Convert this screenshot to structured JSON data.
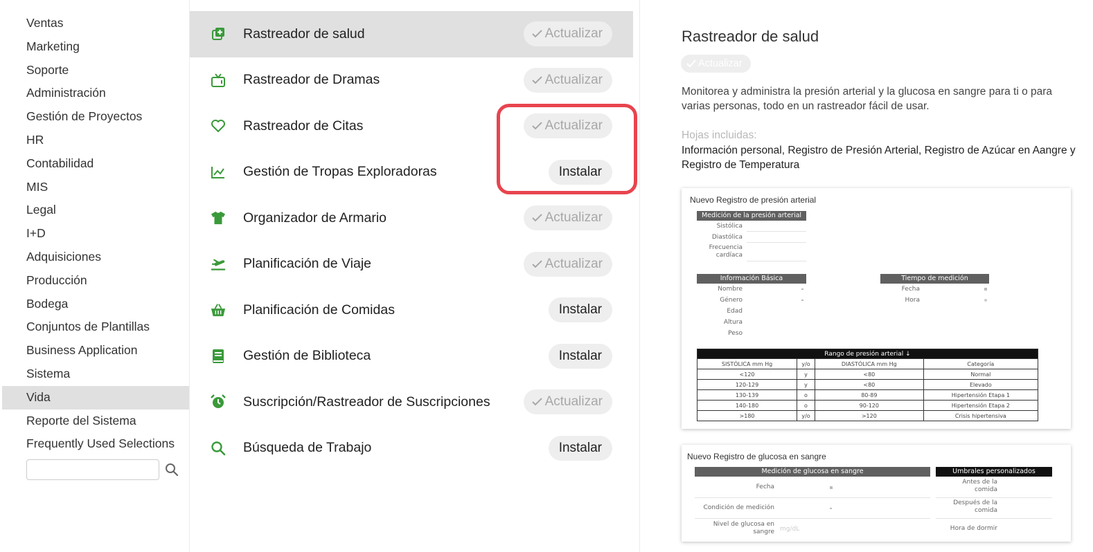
{
  "sidebar": {
    "items": [
      {
        "label": "Ventas"
      },
      {
        "label": "Marketing"
      },
      {
        "label": "Soporte"
      },
      {
        "label": "Administración"
      },
      {
        "label": "Gestión de Proyectos"
      },
      {
        "label": "HR"
      },
      {
        "label": "Contabilidad"
      },
      {
        "label": "MIS"
      },
      {
        "label": "Legal"
      },
      {
        "label": "I+D"
      },
      {
        "label": "Adquisiciones"
      },
      {
        "label": "Producción"
      },
      {
        "label": "Bodega"
      },
      {
        "label": "Conjuntos de Plantillas"
      },
      {
        "label": "Business Application"
      },
      {
        "label": "Sistema"
      },
      {
        "label": "Vida",
        "active": true
      },
      {
        "label": "Reporte del Sistema"
      },
      {
        "label": "Frequently Used Selections"
      }
    ],
    "search_placeholder": ""
  },
  "templates": {
    "items": [
      {
        "name": "Rastreador de salud",
        "action": "Actualizar",
        "icon": "health-plus-icon",
        "selected": true
      },
      {
        "name": "Rastreador de Dramas",
        "action": "Actualizar",
        "icon": "tv-icon"
      },
      {
        "name": "Rastreador de Citas",
        "action": "Actualizar",
        "icon": "heart-icon"
      },
      {
        "name": "Gestión de Tropas Exploradoras",
        "action": "Instalar",
        "icon": "line-chart-icon"
      },
      {
        "name": "Organizador de Armario",
        "action": "Actualizar",
        "icon": "tshirt-icon"
      },
      {
        "name": "Planificación de Viaje",
        "action": "Actualizar",
        "icon": "plane-icon"
      },
      {
        "name": "Planificación de Comidas",
        "action": "Instalar",
        "icon": "basket-icon"
      },
      {
        "name": "Gestión de Biblioteca",
        "action": "Instalar",
        "icon": "book-icon"
      },
      {
        "name": "Suscripción/Rastreador de Suscripciones",
        "action": "Actualizar",
        "icon": "alarm-icon"
      },
      {
        "name": "Búsqueda de Trabajo",
        "action": "Instalar",
        "icon": "search-icon"
      }
    ],
    "accent_color": "#3a9a3a",
    "highlight_color": "#e8444e"
  },
  "detail": {
    "title": "Rastreador de salud",
    "badge": "Actualizar",
    "description": "Monitorea y administra la presión arterial y la glucosa en sangre para ti o para varias personas, todo en un rastreador fácil de usar.",
    "sheets_label": "Hojas incluidas:",
    "sheets": "Información personal, Registro de Presión Arterial, Registro de Azúcar en Aangre y Registro de Temperatura",
    "preview1": {
      "title": "Nuevo Registro de presión arterial",
      "bp_header": "Medición de la presión arterial",
      "bp_fields": [
        "Sistólica",
        "Diastólica",
        "Frecuencia cardíaca"
      ],
      "basic_header": "Información Básica",
      "basic_fields": [
        "Nombre",
        "Género",
        "Edad",
        "Altura",
        "Peso"
      ],
      "time_header": "Tiempo de medición",
      "time_fields": [
        "Fecha",
        "Hora"
      ],
      "range_title": "Rango de presión arterial ↓",
      "range_columns": [
        "SISTÓLICA mm Hg",
        "y/o",
        "DIASTÓLICA mm Hg",
        "Categoría"
      ],
      "range_rows": [
        [
          "<120",
          "y",
          "<80",
          "Normal"
        ],
        [
          "120-129",
          "y",
          "<80",
          "Elevado"
        ],
        [
          "130-139",
          "o",
          "80-89",
          "Hipertensión Etapa 1"
        ],
        [
          "140-180",
          "o",
          "90-120",
          "Hipertensión Etapa 2"
        ],
        [
          ">180",
          "y/o",
          ">120",
          "Crisis hipertensiva"
        ]
      ]
    },
    "preview2": {
      "title": "Nuevo Registro de glucosa en sangre",
      "glucose_header": "Medición de glucosa en sangre",
      "glucose_fields": [
        "Fecha",
        "Condición de medición",
        "Nivel de glucosa en sangre"
      ],
      "glucose_unit": "mg/dL",
      "thresholds_header": "Umbrales personalizados",
      "threshold_fields": [
        "Antes de la comida",
        "Después de la comida",
        "Hora de dormir"
      ]
    }
  }
}
